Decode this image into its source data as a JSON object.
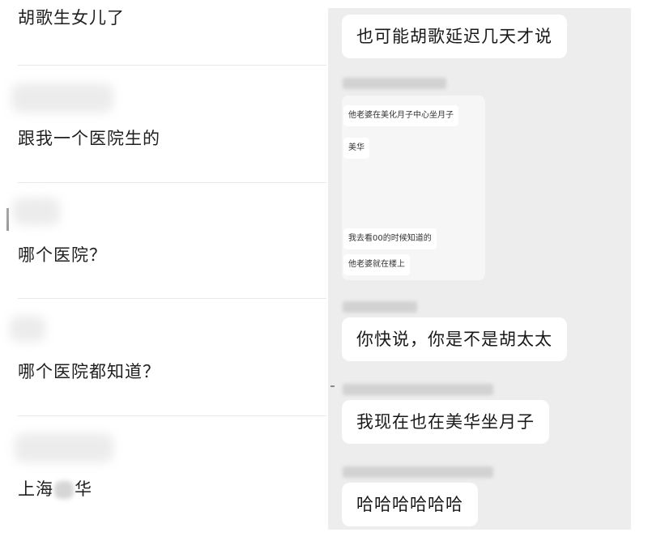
{
  "left_comments": [
    {
      "text": "胡歌生女儿了"
    },
    {
      "text": "跟我一个医院生的"
    },
    {
      "text": "哪个医院？"
    },
    {
      "text": "哪个医院都知道？"
    },
    {
      "text_before": "上海",
      "text_after": "华"
    }
  ],
  "chat": {
    "messages_top": [
      {
        "text": "也可能胡歌延迟几天才说"
      }
    ],
    "forwarded_image": {
      "lines": [
        "他老婆在美化月子中心坐月子",
        "美华",
        "我去看00的时候知道的",
        "他老婆就在楼上"
      ]
    },
    "messages_bottom": [
      {
        "text": "你快说，你是不是胡太太"
      },
      {
        "text": "我现在也在美华坐月子"
      },
      {
        "text": "哈哈哈哈哈哈"
      }
    ]
  },
  "colors": {
    "chat_background": "#ededed",
    "bubble_background": "#ffffff",
    "divider": "#e8e8e8",
    "text": "#1f1f1f"
  }
}
